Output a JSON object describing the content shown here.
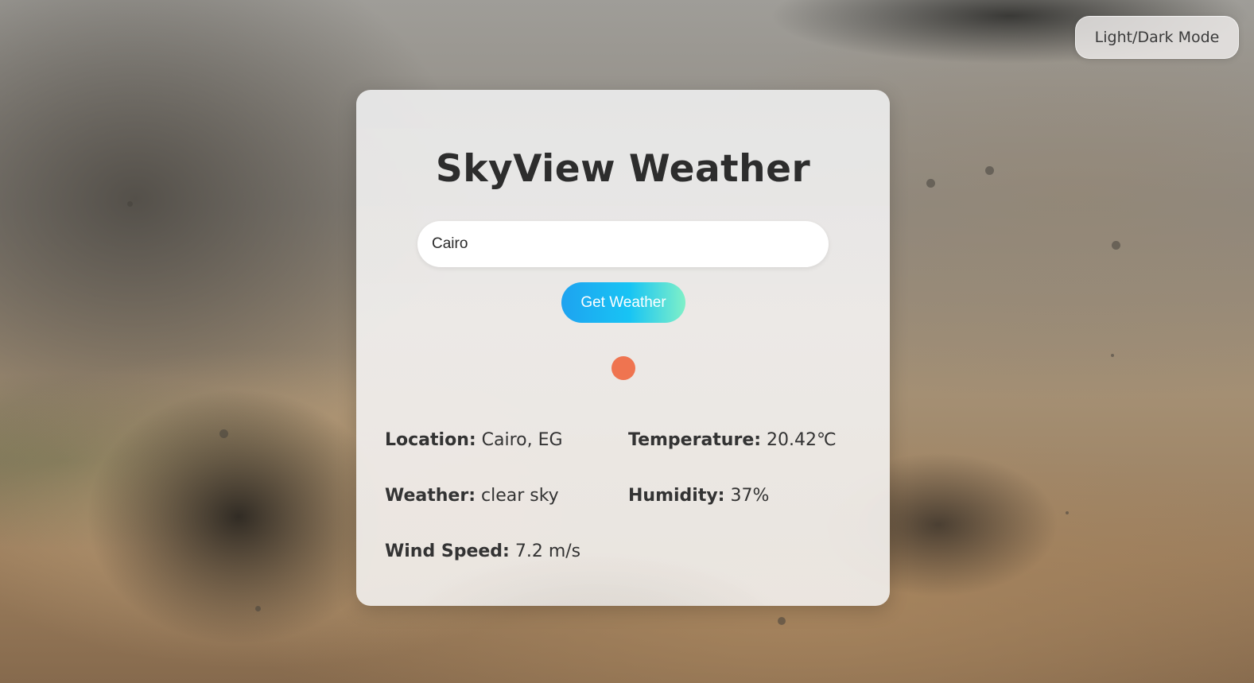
{
  "header": {
    "mode_toggle_label": "Light/Dark Mode"
  },
  "card": {
    "title": "SkyView Weather",
    "search": {
      "value": "Cairo",
      "placeholder": ""
    },
    "get_weather_label": "Get Weather",
    "weather_icon": "sun-icon",
    "details": {
      "location": {
        "label": "Location:",
        "value": "Cairo, EG"
      },
      "temperature": {
        "label": "Temperature:",
        "value": "20.42℃"
      },
      "weather": {
        "label": "Weather:",
        "value": "clear sky"
      },
      "humidity": {
        "label": "Humidity:",
        "value": "37%"
      },
      "wind_speed": {
        "label": "Wind Speed:",
        "value": "7.2 m/s"
      }
    }
  },
  "colors": {
    "weather_icon": "#ef7450",
    "button_gradient_start": "#1ea3f0",
    "button_gradient_end": "#7ff0c8",
    "text": "#2d2d2d"
  }
}
